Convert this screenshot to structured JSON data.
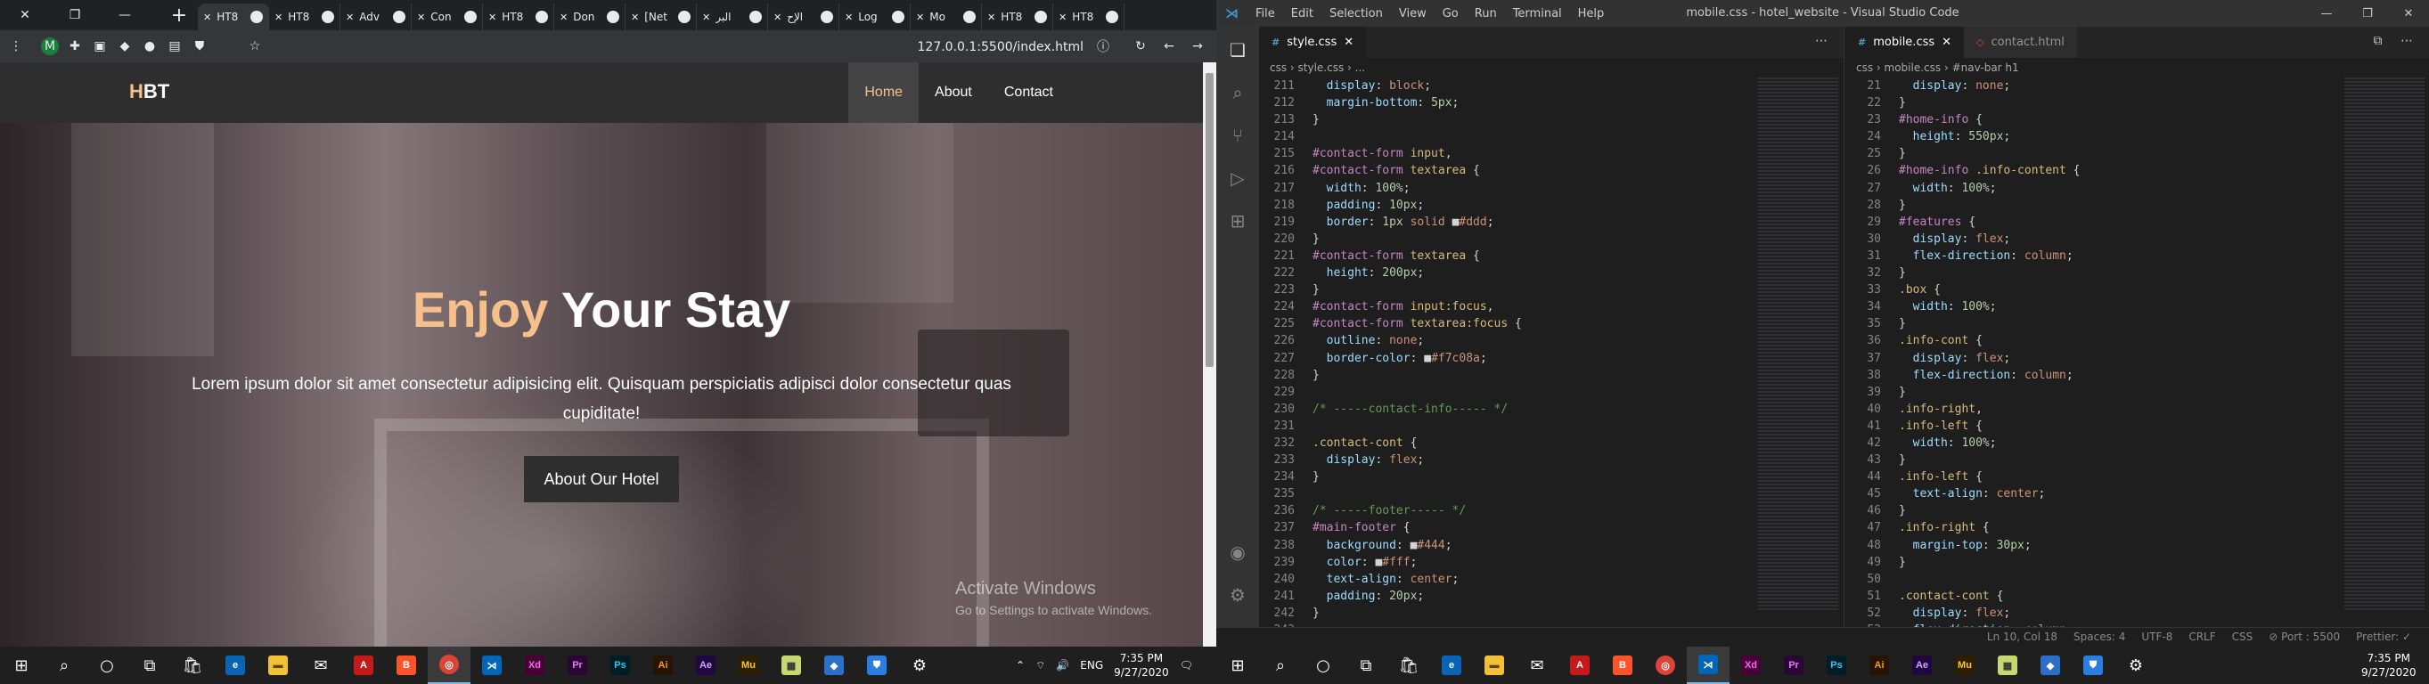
{
  "chrome": {
    "tabs": [
      {
        "label": "HT8",
        "active": true
      },
      {
        "label": "HT8"
      },
      {
        "label": "Adv"
      },
      {
        "label": "Con"
      },
      {
        "label": "HT8"
      },
      {
        "label": "Don"
      },
      {
        "label": "[Net"
      },
      {
        "label": "البر"
      },
      {
        "label": "الإح"
      },
      {
        "label": "Log"
      },
      {
        "label": "Mo"
      },
      {
        "label": "HT8"
      },
      {
        "label": "HT8"
      }
    ],
    "url": "127.0.0.1:5500/index.html",
    "profile_initial": "M"
  },
  "site": {
    "logo_h": "H",
    "logo_rest": "BT",
    "nav": [
      "Home",
      "About",
      "Contact"
    ],
    "hero_accent": "Enjoy",
    "hero_title_rest": " Your Stay",
    "hero_text": "Lorem ipsum dolor sit amet consectetur adipisicing elit. Quisquam perspiciatis adipisci dolor consectetur quas cupiditate!",
    "hero_button": "About Our Hotel",
    "activate_title": "Activate Windows",
    "activate_sub": "Go to Settings to activate Windows."
  },
  "vscode": {
    "menus": [
      "File",
      "Edit",
      "Selection",
      "View",
      "Go",
      "Run",
      "Terminal",
      "Help"
    ],
    "window_title": "mobile.css - hotel_website - Visual Studio Code",
    "left_tab": "style.css",
    "left_breadcrumb": "css › style.css › ...",
    "right_tabs": [
      "mobile.css",
      "contact.html"
    ],
    "right_breadcrumb": "css › mobile.css › #nav-bar h1",
    "left_lines": [
      {
        "n": "211",
        "t": [
          [
            "c-prop",
            "  display"
          ],
          [
            "c-pun",
            ": "
          ],
          [
            "c-val",
            "block"
          ],
          [
            "c-pun",
            ";"
          ]
        ]
      },
      {
        "n": "212",
        "t": [
          [
            "c-prop",
            "  margin-bottom"
          ],
          [
            "c-pun",
            ": "
          ],
          [
            "c-num",
            "5px"
          ],
          [
            "c-pun",
            ";"
          ]
        ]
      },
      {
        "n": "213",
        "t": [
          [
            "c-pun",
            "}"
          ]
        ]
      },
      {
        "n": "214",
        "t": []
      },
      {
        "n": "215",
        "t": [
          [
            "c-id",
            "#contact-form "
          ],
          [
            "c-sel",
            "input"
          ],
          [
            "c-pun",
            ","
          ]
        ]
      },
      {
        "n": "216",
        "t": [
          [
            "c-id",
            "#contact-form "
          ],
          [
            "c-sel",
            "textarea"
          ],
          [
            "c-pun",
            " {"
          ]
        ]
      },
      {
        "n": "217",
        "t": [
          [
            "c-prop",
            "  width"
          ],
          [
            "c-pun",
            ": "
          ],
          [
            "c-num",
            "100%"
          ],
          [
            "c-pun",
            ";"
          ]
        ]
      },
      {
        "n": "218",
        "t": [
          [
            "c-prop",
            "  padding"
          ],
          [
            "c-pun",
            ": "
          ],
          [
            "c-num",
            "10px"
          ],
          [
            "c-pun",
            ";"
          ]
        ]
      },
      {
        "n": "219",
        "t": [
          [
            "c-prop",
            "  border"
          ],
          [
            "c-pun",
            ": "
          ],
          [
            "c-num",
            "1px "
          ],
          [
            "c-val",
            "solid "
          ],
          [
            "c-pun",
            "■"
          ],
          [
            "c-val",
            "#ddd"
          ],
          [
            "c-pun",
            ";"
          ]
        ]
      },
      {
        "n": "220",
        "t": [
          [
            "c-pun",
            "}"
          ]
        ]
      },
      {
        "n": "221",
        "t": [
          [
            "c-id",
            "#contact-form "
          ],
          [
            "c-sel",
            "textarea"
          ],
          [
            "c-pun",
            " {"
          ]
        ]
      },
      {
        "n": "222",
        "t": [
          [
            "c-prop",
            "  height"
          ],
          [
            "c-pun",
            ": "
          ],
          [
            "c-num",
            "200px"
          ],
          [
            "c-pun",
            ";"
          ]
        ]
      },
      {
        "n": "223",
        "t": [
          [
            "c-pun",
            "}"
          ]
        ]
      },
      {
        "n": "224",
        "t": [
          [
            "c-id",
            "#contact-form "
          ],
          [
            "c-sel",
            "input:focus"
          ],
          [
            "c-pun",
            ","
          ]
        ]
      },
      {
        "n": "225",
        "t": [
          [
            "c-id",
            "#contact-form "
          ],
          [
            "c-sel",
            "textarea:focus"
          ],
          [
            "c-pun",
            " {"
          ]
        ]
      },
      {
        "n": "226",
        "t": [
          [
            "c-prop",
            "  outline"
          ],
          [
            "c-pun",
            ": "
          ],
          [
            "c-val",
            "none"
          ],
          [
            "c-pun",
            ";"
          ]
        ]
      },
      {
        "n": "227",
        "t": [
          [
            "c-prop",
            "  border-color"
          ],
          [
            "c-pun",
            ": "
          ],
          [
            "c-pun",
            "■"
          ],
          [
            "c-val",
            "#f7c08a"
          ],
          [
            "c-pun",
            ";"
          ]
        ]
      },
      {
        "n": "228",
        "t": [
          [
            "c-pun",
            "}"
          ]
        ]
      },
      {
        "n": "229",
        "t": []
      },
      {
        "n": "230",
        "t": [
          [
            "c-com",
            "/* -----contact-info----- */"
          ]
        ]
      },
      {
        "n": "231",
        "t": []
      },
      {
        "n": "232",
        "t": [
          [
            "c-sel",
            ".contact-cont"
          ],
          [
            "c-pun",
            " {"
          ]
        ]
      },
      {
        "n": "233",
        "t": [
          [
            "c-prop",
            "  display"
          ],
          [
            "c-pun",
            ": "
          ],
          [
            "c-val",
            "flex"
          ],
          [
            "c-pun",
            ";"
          ]
        ]
      },
      {
        "n": "234",
        "t": [
          [
            "c-pun",
            "}"
          ]
        ]
      },
      {
        "n": "235",
        "t": []
      },
      {
        "n": "236",
        "t": [
          [
            "c-com",
            "/* -----footer----- */"
          ]
        ]
      },
      {
        "n": "237",
        "t": [
          [
            "c-id",
            "#main-footer"
          ],
          [
            "c-pun",
            " {"
          ]
        ]
      },
      {
        "n": "238",
        "t": [
          [
            "c-prop",
            "  background"
          ],
          [
            "c-pun",
            ": "
          ],
          [
            "c-pun",
            "■"
          ],
          [
            "c-val",
            "#444"
          ],
          [
            "c-pun",
            ";"
          ]
        ]
      },
      {
        "n": "239",
        "t": [
          [
            "c-prop",
            "  color"
          ],
          [
            "c-pun",
            ": "
          ],
          [
            "c-pun",
            "■"
          ],
          [
            "c-val",
            "#fff"
          ],
          [
            "c-pun",
            ";"
          ]
        ]
      },
      {
        "n": "240",
        "t": [
          [
            "c-prop",
            "  text-align"
          ],
          [
            "c-pun",
            ": "
          ],
          [
            "c-val",
            "center"
          ],
          [
            "c-pun",
            ";"
          ]
        ]
      },
      {
        "n": "241",
        "t": [
          [
            "c-prop",
            "  padding"
          ],
          [
            "c-pun",
            ": "
          ],
          [
            "c-num",
            "20px"
          ],
          [
            "c-pun",
            ";"
          ]
        ]
      },
      {
        "n": "242",
        "t": [
          [
            "c-pun",
            "}"
          ]
        ]
      },
      {
        "n": "243",
        "t": []
      }
    ],
    "right_lines": [
      {
        "n": "21",
        "t": [
          [
            "c-prop",
            "  display"
          ],
          [
            "c-pun",
            ": "
          ],
          [
            "c-val",
            "none"
          ],
          [
            "c-pun",
            ";"
          ]
        ]
      },
      {
        "n": "22",
        "t": [
          [
            "c-pun",
            "}"
          ]
        ]
      },
      {
        "n": "23",
        "t": [
          [
            "c-id",
            "#home-info"
          ],
          [
            "c-pun",
            " {"
          ]
        ]
      },
      {
        "n": "24",
        "t": [
          [
            "c-prop",
            "  height"
          ],
          [
            "c-pun",
            ": "
          ],
          [
            "c-num",
            "550px"
          ],
          [
            "c-pun",
            ";"
          ]
        ]
      },
      {
        "n": "25",
        "t": [
          [
            "c-pun",
            "}"
          ]
        ]
      },
      {
        "n": "26",
        "t": [
          [
            "c-id",
            "#home-info "
          ],
          [
            "c-sel",
            ".info-content"
          ],
          [
            "c-pun",
            " {"
          ]
        ]
      },
      {
        "n": "27",
        "t": [
          [
            "c-prop",
            "  width"
          ],
          [
            "c-pun",
            ": "
          ],
          [
            "c-num",
            "100%"
          ],
          [
            "c-pun",
            ";"
          ]
        ]
      },
      {
        "n": "28",
        "t": [
          [
            "c-pun",
            "}"
          ]
        ]
      },
      {
        "n": "29",
        "t": [
          [
            "c-id",
            "#features"
          ],
          [
            "c-pun",
            " {"
          ]
        ]
      },
      {
        "n": "30",
        "t": [
          [
            "c-prop",
            "  display"
          ],
          [
            "c-pun",
            ": "
          ],
          [
            "c-val",
            "flex"
          ],
          [
            "c-pun",
            ";"
          ]
        ]
      },
      {
        "n": "31",
        "t": [
          [
            "c-prop",
            "  flex-direction"
          ],
          [
            "c-pun",
            ": "
          ],
          [
            "c-val",
            "column"
          ],
          [
            "c-pun",
            ";"
          ]
        ]
      },
      {
        "n": "32",
        "t": [
          [
            "c-pun",
            "}"
          ]
        ]
      },
      {
        "n": "33",
        "t": [
          [
            "c-sel",
            ".box"
          ],
          [
            "c-pun",
            " {"
          ]
        ]
      },
      {
        "n": "34",
        "t": [
          [
            "c-prop",
            "  width"
          ],
          [
            "c-pun",
            ": "
          ],
          [
            "c-num",
            "100%"
          ],
          [
            "c-pun",
            ";"
          ]
        ]
      },
      {
        "n": "35",
        "t": [
          [
            "c-pun",
            "}"
          ]
        ]
      },
      {
        "n": "36",
        "t": [
          [
            "c-sel",
            ".info-cont"
          ],
          [
            "c-pun",
            " {"
          ]
        ]
      },
      {
        "n": "37",
        "t": [
          [
            "c-prop",
            "  display"
          ],
          [
            "c-pun",
            ": "
          ],
          [
            "c-val",
            "flex"
          ],
          [
            "c-pun",
            ";"
          ]
        ]
      },
      {
        "n": "38",
        "t": [
          [
            "c-prop",
            "  flex-direction"
          ],
          [
            "c-pun",
            ": "
          ],
          [
            "c-val",
            "column"
          ],
          [
            "c-pun",
            ";"
          ]
        ]
      },
      {
        "n": "39",
        "t": [
          [
            "c-pun",
            "}"
          ]
        ]
      },
      {
        "n": "40",
        "t": [
          [
            "c-sel",
            ".info-right"
          ],
          [
            "c-pun",
            ","
          ]
        ]
      },
      {
        "n": "41",
        "t": [
          [
            "c-sel",
            ".info-left"
          ],
          [
            "c-pun",
            " {"
          ]
        ]
      },
      {
        "n": "42",
        "t": [
          [
            "c-prop",
            "  width"
          ],
          [
            "c-pun",
            ": "
          ],
          [
            "c-num",
            "100%"
          ],
          [
            "c-pun",
            ";"
          ]
        ]
      },
      {
        "n": "43",
        "t": [
          [
            "c-pun",
            "}"
          ]
        ]
      },
      {
        "n": "44",
        "t": [
          [
            "c-sel",
            ".info-left"
          ],
          [
            "c-pun",
            " {"
          ]
        ]
      },
      {
        "n": "45",
        "t": [
          [
            "c-prop",
            "  text-align"
          ],
          [
            "c-pun",
            ": "
          ],
          [
            "c-val",
            "center"
          ],
          [
            "c-pun",
            ";"
          ]
        ]
      },
      {
        "n": "46",
        "t": [
          [
            "c-pun",
            "}"
          ]
        ]
      },
      {
        "n": "47",
        "t": [
          [
            "c-sel",
            ".info-right"
          ],
          [
            "c-pun",
            " {"
          ]
        ]
      },
      {
        "n": "48",
        "t": [
          [
            "c-prop",
            "  margin-top"
          ],
          [
            "c-pun",
            ": "
          ],
          [
            "c-num",
            "30px"
          ],
          [
            "c-pun",
            ";"
          ]
        ]
      },
      {
        "n": "49",
        "t": [
          [
            "c-pun",
            "}"
          ]
        ]
      },
      {
        "n": "50",
        "t": []
      },
      {
        "n": "51",
        "t": [
          [
            "c-sel",
            ".contact-cont"
          ],
          [
            "c-pun",
            " {"
          ]
        ]
      },
      {
        "n": "52",
        "t": [
          [
            "c-prop",
            "  display"
          ],
          [
            "c-pun",
            ": "
          ],
          [
            "c-val",
            "flex"
          ],
          [
            "c-pun",
            ";"
          ]
        ]
      },
      {
        "n": "53",
        "t": [
          [
            "c-prop",
            "  flex-direction"
          ],
          [
            "c-pun",
            ": "
          ],
          [
            "c-val",
            "column"
          ],
          [
            "c-pun",
            ";"
          ]
        ]
      }
    ],
    "status": [
      "Ln 10, Col 18",
      "Spaces: 4",
      "UTF-8",
      "CRLF",
      "CSS",
      "⊘ Port : 5500",
      "Prettier: ✓"
    ]
  },
  "taskbar": {
    "lang": "ENG",
    "time": "7:35 PM",
    "date": "9/27/2020"
  },
  "colors": {
    "accent": "#f7c08a",
    "navbar": "#2e2e2e"
  }
}
